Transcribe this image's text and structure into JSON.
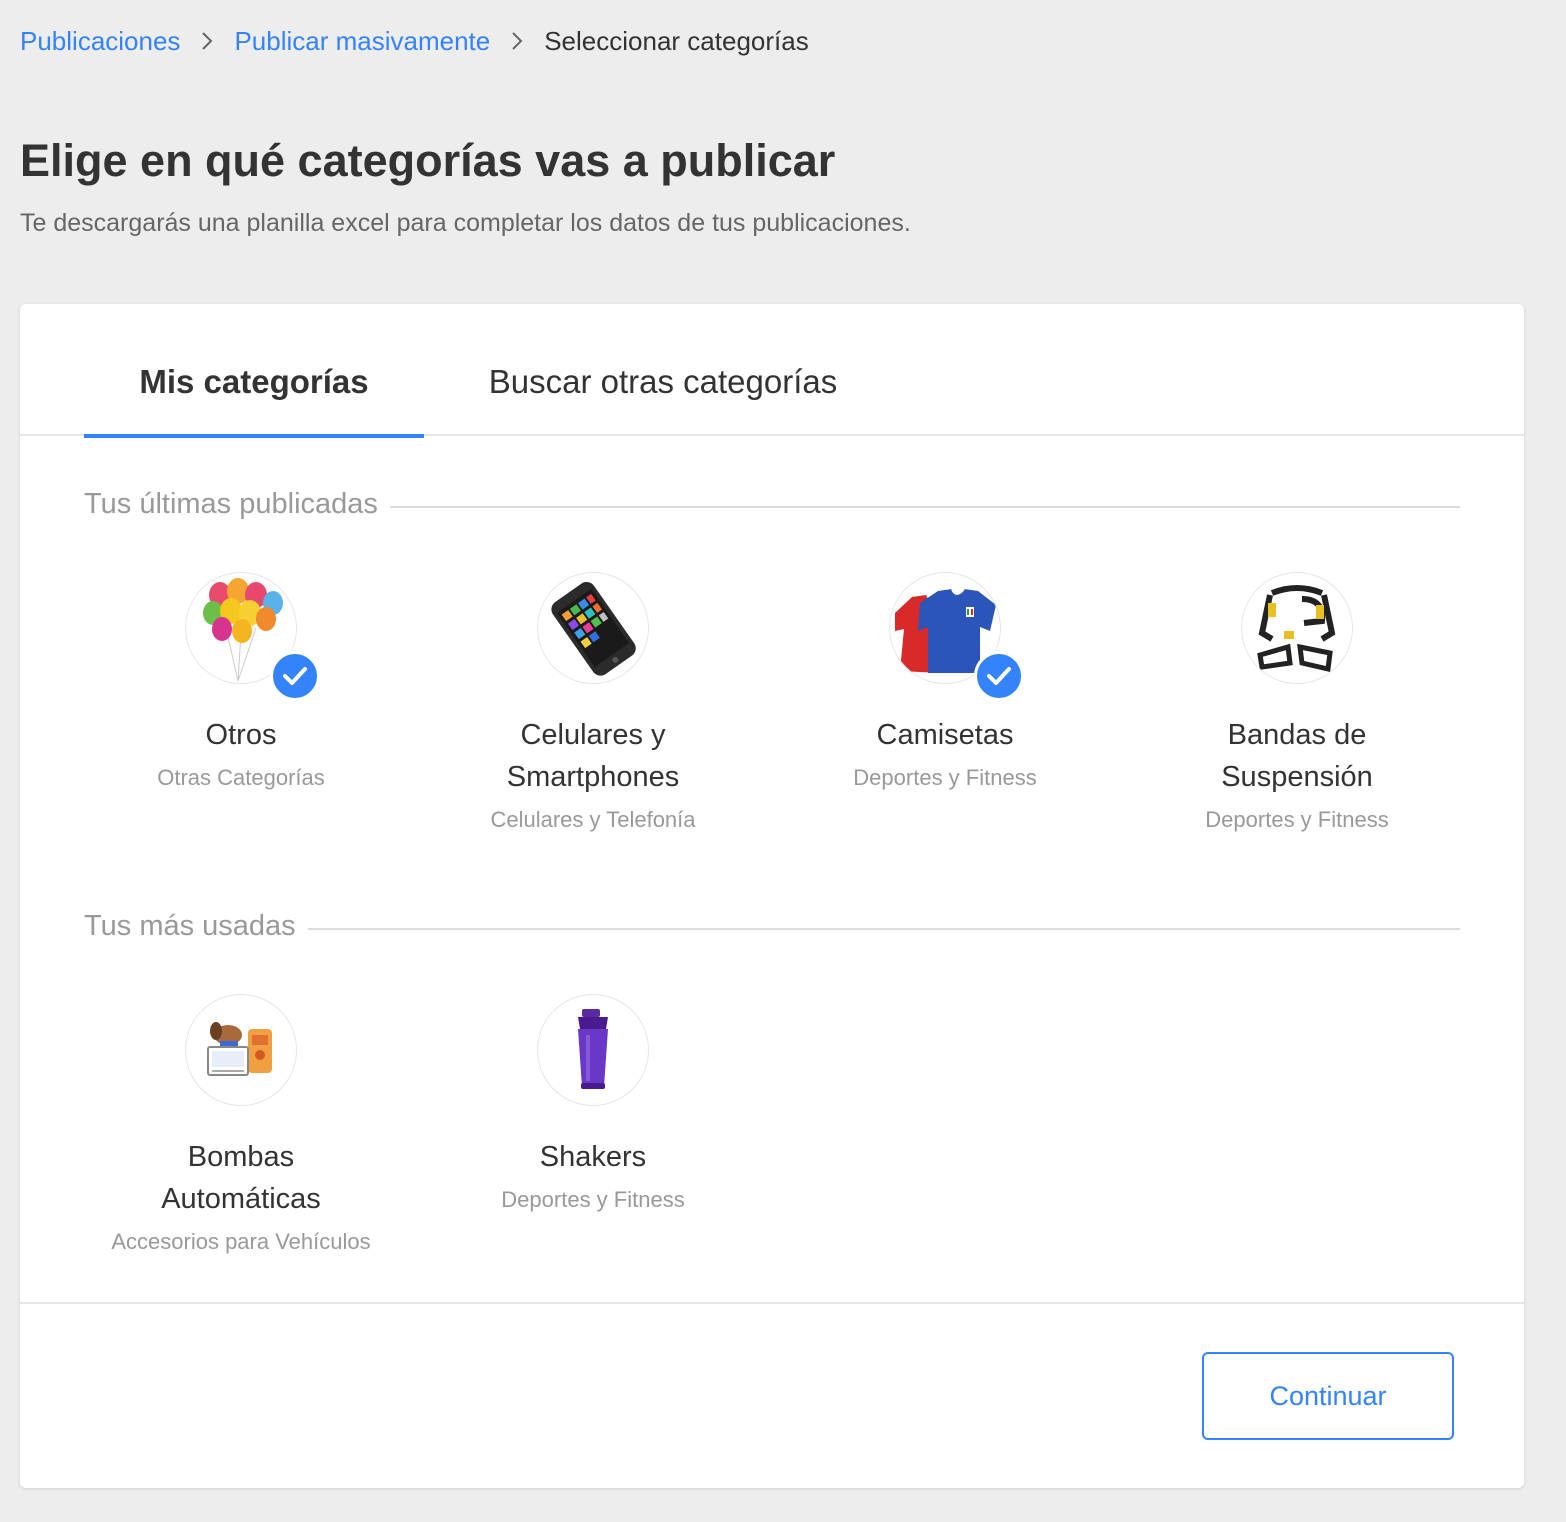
{
  "breadcrumb": {
    "items": [
      {
        "label": "Publicaciones"
      },
      {
        "label": "Publicar masivamente"
      },
      {
        "label": "Seleccionar categorías"
      }
    ]
  },
  "header": {
    "title": "Elige en qué categorías vas a publicar",
    "subtitle": "Te descargarás una planilla excel para completar los datos de tus publicaciones."
  },
  "tabs": [
    {
      "label": "Mis categorías",
      "active": true
    },
    {
      "label": "Buscar otras categorías",
      "active": false
    }
  ],
  "sections": [
    {
      "label": "Tus últimas publicadas",
      "categories": [
        {
          "name": "Otros",
          "parent": "Otras Categorías",
          "icon": "balloons-icon",
          "selected": true
        },
        {
          "name": "Celulares y Smartphones",
          "parent": "Celulares y Telefonía",
          "icon": "smartphone-icon",
          "selected": false
        },
        {
          "name": "Camisetas",
          "parent": "Deportes y Fitness",
          "icon": "jersey-icon",
          "selected": true
        },
        {
          "name": "Bandas de Suspensión",
          "parent": "Deportes y Fitness",
          "icon": "suspension-straps-icon",
          "selected": false
        }
      ]
    },
    {
      "label": "Tus más usadas",
      "categories": [
        {
          "name": "Bombas Automáticas",
          "parent": "Accesorios para Vehículos",
          "icon": "pet-accessories-icon",
          "selected": false
        },
        {
          "name": "Shakers",
          "parent": "Deportes y Fitness",
          "icon": "shaker-bottle-icon",
          "selected": false
        }
      ]
    }
  ],
  "footer": {
    "continue_label": "Continuar"
  },
  "colors": {
    "accent": "#3483fa",
    "background": "#ededed",
    "text": "#333333",
    "muted": "#999999"
  }
}
